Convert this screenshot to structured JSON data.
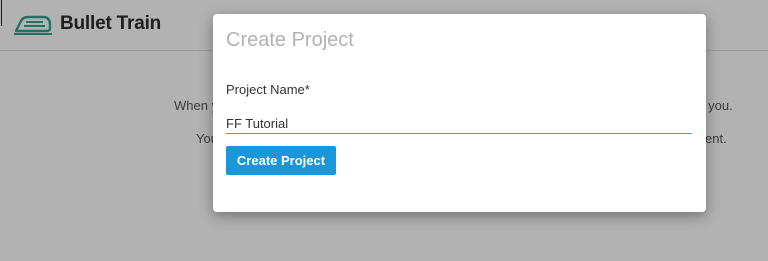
{
  "app": {
    "name": "Bullet Train",
    "background_lines": [
      {
        "left": "When y",
        "right": "or you."
      },
      {
        "left": "You",
        "right": "ent."
      }
    ]
  },
  "modal": {
    "title": "Create Project",
    "field": {
      "label": "Project Name*",
      "value": "FF Tutorial"
    },
    "submit_label": "Create Project"
  },
  "colors": {
    "brand_accent": "#2fa58e",
    "primary_button": "#1a96d9",
    "input_underline": "#3aa7d9",
    "backdrop": "rgba(0,0,0,0.30)"
  }
}
